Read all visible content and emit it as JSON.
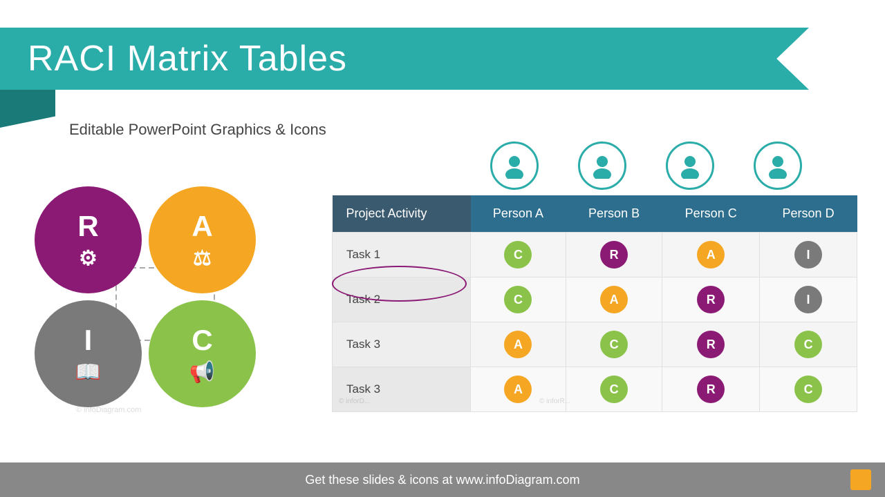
{
  "header": {
    "title": "RACI Matrix Tables",
    "subtitle": "Editable PowerPoint Graphics & Icons"
  },
  "raci_legend": {
    "r_label": "R",
    "a_label": "A",
    "i_label": "I",
    "c_label": "C"
  },
  "table": {
    "col_activity": "Project Activity",
    "col_persons": [
      "Person A",
      "Person B",
      "Person C",
      "Person D"
    ],
    "rows": [
      {
        "task": "Task 1",
        "cells": [
          {
            "letter": "C",
            "type": "c"
          },
          {
            "letter": "R",
            "type": "r"
          },
          {
            "letter": "A",
            "type": "a"
          },
          {
            "letter": "I",
            "type": "i"
          }
        ]
      },
      {
        "task": "Task 2",
        "cells": [
          {
            "letter": "C",
            "type": "c"
          },
          {
            "letter": "A",
            "type": "a"
          },
          {
            "letter": "R",
            "type": "r"
          },
          {
            "letter": "I",
            "type": "i"
          }
        ]
      },
      {
        "task": "Task 3",
        "cells": [
          {
            "letter": "A",
            "type": "a"
          },
          {
            "letter": "C",
            "type": "c"
          },
          {
            "letter": "R",
            "type": "r"
          },
          {
            "letter": "C",
            "type": "c"
          }
        ]
      },
      {
        "task": "Task 3",
        "cells": [
          {
            "letter": "A",
            "type": "a"
          },
          {
            "letter": "C",
            "type": "c"
          },
          {
            "letter": "R",
            "type": "r"
          },
          {
            "letter": "C",
            "type": "c"
          }
        ]
      }
    ]
  },
  "footer": {
    "text": "Get these slides & icons at www.infoDiagram.com"
  }
}
